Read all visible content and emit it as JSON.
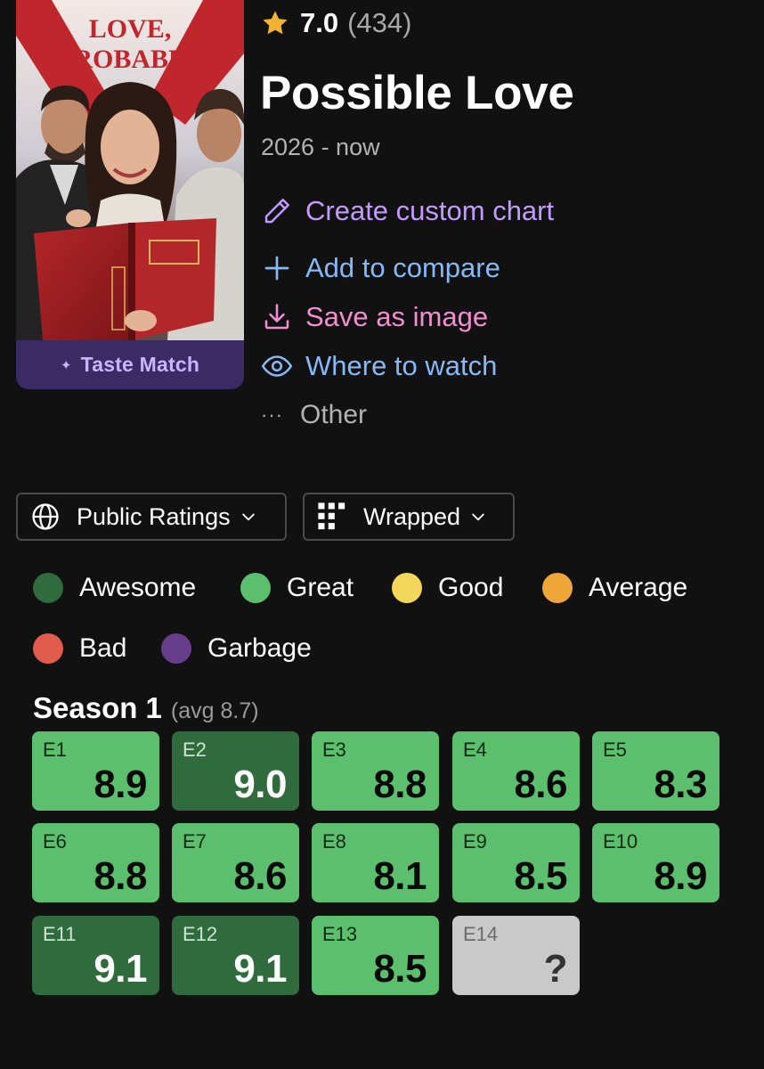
{
  "poster": {
    "logo_line1": "LOVE,",
    "logo_line2": "PROBABLY",
    "taste_match_label": "Taste Match"
  },
  "show": {
    "rating": "7.0",
    "rating_count": "(434)",
    "title": "Possible Love",
    "years": "2026 - now"
  },
  "actions": {
    "create_chart": "Create custom chart",
    "add_compare": "Add to compare",
    "save_image": "Save as image",
    "where_watch": "Where to watch",
    "other": "Other"
  },
  "controls": {
    "ratings_source": "Public Ratings",
    "layout_mode": "Wrapped"
  },
  "legend": [
    {
      "label": "Awesome",
      "color": "#2f6b3d"
    },
    {
      "label": "Great",
      "color": "#5cbf6e"
    },
    {
      "label": "Good",
      "color": "#f2d75a"
    },
    {
      "label": "Average",
      "color": "#eea638"
    },
    {
      "label": "Bad",
      "color": "#e25c4d"
    },
    {
      "label": "Garbage",
      "color": "#663d8a"
    }
  ],
  "season": {
    "title": "Season 1",
    "avg": "(avg 8.7)",
    "episodes": [
      {
        "label": "E1",
        "score": "8.9",
        "tier": "Great"
      },
      {
        "label": "E2",
        "score": "9.0",
        "tier": "Awesome"
      },
      {
        "label": "E3",
        "score": "8.8",
        "tier": "Great"
      },
      {
        "label": "E4",
        "score": "8.6",
        "tier": "Great"
      },
      {
        "label": "E5",
        "score": "8.3",
        "tier": "Great"
      },
      {
        "label": "E6",
        "score": "8.8",
        "tier": "Great"
      },
      {
        "label": "E7",
        "score": "8.6",
        "tier": "Great"
      },
      {
        "label": "E8",
        "score": "8.1",
        "tier": "Great"
      },
      {
        "label": "E9",
        "score": "8.5",
        "tier": "Great"
      },
      {
        "label": "E10",
        "score": "8.9",
        "tier": "Great"
      },
      {
        "label": "E11",
        "score": "9.1",
        "tier": "Awesome"
      },
      {
        "label": "E12",
        "score": "9.1",
        "tier": "Awesome"
      },
      {
        "label": "E13",
        "score": "8.5",
        "tier": "Great"
      },
      {
        "label": "E14",
        "score": "?",
        "tier": "Unrated"
      }
    ]
  },
  "tier_styles": {
    "Awesome": {
      "bg": "#2f6b3d",
      "label": "#cfe3d3",
      "score": "#ffffff"
    },
    "Great": {
      "bg": "#5cbf6e",
      "label": "#0f2a15",
      "score": "#0a0a0a"
    },
    "Unrated": {
      "bg": "#c9c9c9",
      "label": "#6b6b6b",
      "score": "#333333"
    }
  },
  "accent_colors": {
    "star": "#f2b233",
    "custom_chart": "#c39bff",
    "compare": "#86b9f5",
    "save": "#f28ed2",
    "taste_match_bg": "#3a2b64"
  }
}
